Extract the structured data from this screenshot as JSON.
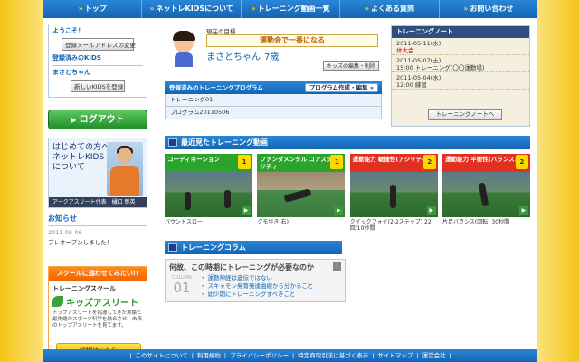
{
  "nav": [
    {
      "label": "トップ"
    },
    {
      "label": "ネットレKIDSについて"
    },
    {
      "label": "トレーニング動画一覧"
    },
    {
      "label": "よくある質問"
    },
    {
      "label": "お問い合わせ"
    }
  ],
  "sidebar": {
    "welcome_title": "ようこそ！",
    "change_email": "登録メールアドレスの変更",
    "registered_kids": "登録済みのKIDS",
    "kid_name": "まさとちゃん",
    "register_new": "新しいKIDSを登録",
    "logout": "ログアウト",
    "beginner_text": "はじめての方へネットレKIDSについて",
    "beginner_caption": "アークアスリート代表　樋口 彰英",
    "news_title": "お知らせ",
    "news_date": "2011-05-06",
    "news_body": "プレオープンしました！",
    "school_banner": "スクールに通わせてみたい!!",
    "school_sub": "トレーニングスクール",
    "school_logo": "キッズアスリート",
    "school_desc": "トップアスリートを指導してきた実績と最先端のスポーツ科学を融合させ、未来のトップアスリートを育てます。",
    "school_more": "詳細はこちら"
  },
  "profile": {
    "goal_label": "現在の目標",
    "goal": "運動会で一番になる",
    "name": "まさとちゃん",
    "age": "7歳",
    "edit_btn": "キッズの編集・削除"
  },
  "programs": {
    "title": "登録済みのトレーニングプログラム",
    "create_btn": "プログラム作成・編集",
    "items": [
      "トレーニング01",
      "プログラム20110506"
    ]
  },
  "notebook": {
    "title": "トレーニングノート",
    "entries": [
      {
        "date": "2011-05-11(水)",
        "text": "体大会",
        "red": true
      },
      {
        "date": "2011-05-07(土)",
        "text": "15:00 トレーニング(〇〇運動場)",
        "red": false
      },
      {
        "date": "2011-05-04(水)",
        "text": "12:00 練習",
        "red": false
      }
    ],
    "button": "トレーニングノートへ"
  },
  "recent": {
    "title": "最近見たトレーニング動画",
    "cards": [
      {
        "category": "コーディネーション",
        "level": "1",
        "caption": "バウンドスロー"
      },
      {
        "category": "ファンダメンタル コアスタビリティ",
        "level": "1",
        "caption": "クモ歩き(右)"
      },
      {
        "category": "運動能力 敏捷性(アジリティ)",
        "level": "2",
        "caption": "クイックフォイ(2-2ステップ) 22回/10秒間"
      },
      {
        "category": "運動能力 平衡性(バランス)",
        "level": "2",
        "caption": "片足バランス(回転) 30秒間"
      }
    ]
  },
  "column": {
    "title": "トレーニングコラム",
    "question": "何故、この時期にトレーニングが必要なのか",
    "badge_word": "COLUMN",
    "badge_num": "01",
    "points": [
      "運動神経は遺伝ではない",
      "スキャモン発育発達曲線から分かること",
      "幼少期にトレーニングすべきこと"
    ]
  },
  "footer": [
    "このサイトについて",
    "利用規約",
    "プライバシーポリシー",
    "特定商取引法に基づく表示",
    "サイトマップ",
    "運営会社"
  ]
}
